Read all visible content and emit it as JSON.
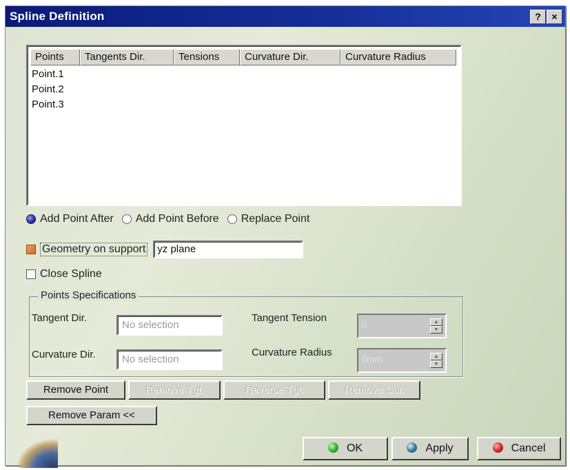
{
  "window": {
    "title": "Spline Definition",
    "help_label": "?",
    "close_label": "×"
  },
  "grid": {
    "columns": [
      "Points",
      "Tangents Dir.",
      "Tensions",
      "Curvature Dir.",
      "Curvature Radius"
    ],
    "rows": [
      "Point.1",
      "Point.2",
      "Point.3"
    ]
  },
  "insert_mode": {
    "options": [
      "Add Point After",
      "Add Point Before",
      "Replace Point"
    ],
    "selected": "Add Point After"
  },
  "geometry_on_support": {
    "label": "Geometry on support",
    "checked": true,
    "value": "yz plane"
  },
  "close_spline": {
    "label": "Close Spline",
    "checked": false
  },
  "points_spec": {
    "title": "Points Specifications",
    "tangent_dir_label": "Tangent Dir.",
    "tangent_dir_value": "No selection",
    "curvature_dir_label": "Curvature Dir.",
    "curvature_dir_value": "No selection",
    "tangent_tension_label": "Tangent Tension",
    "tangent_tension_value": "0",
    "curvature_radius_label": "Curvature Radius",
    "curvature_radius_value": "0mm"
  },
  "point_buttons": {
    "remove_point": "Remove Point",
    "remove_tgt": "Remove Tgt.",
    "reverse_tgt": "Reverse Tgt.",
    "remove_cur": "Remove Cur.",
    "remove_param": "Remove Param <<"
  },
  "dialog_buttons": {
    "ok": "OK",
    "apply": "Apply",
    "cancel": "Cancel"
  },
  "colors": {
    "titlebar": "#0a1a7a",
    "background": "#dde4d2",
    "ok": "#3ab33a",
    "apply": "#3a7e9a",
    "cancel": "#d42a2a"
  }
}
